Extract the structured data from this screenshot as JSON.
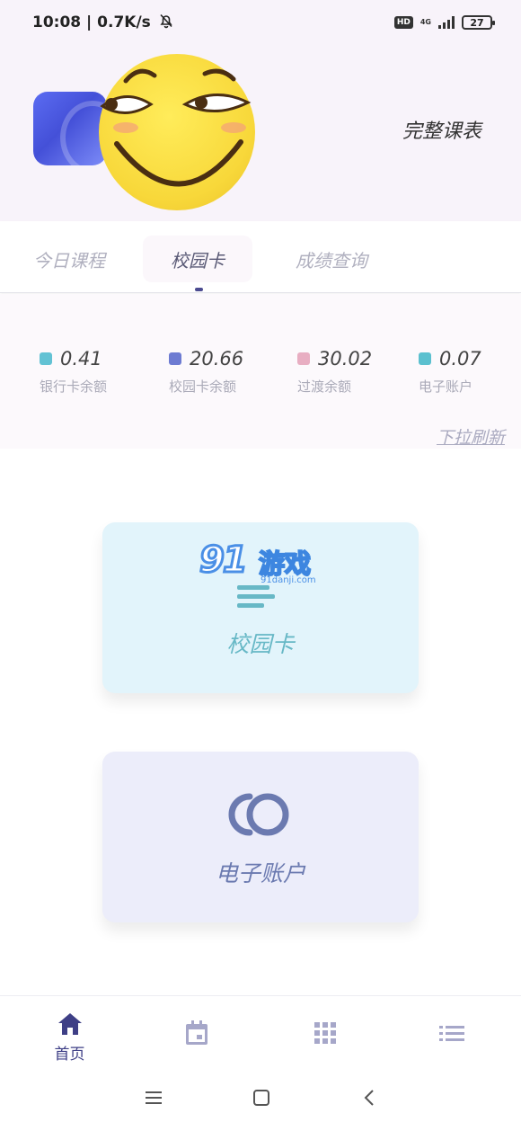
{
  "status_bar": {
    "time_speed": "10:08 | 0.7K/s",
    "hd_badge": "HD",
    "network": "4G",
    "battery": "27"
  },
  "header": {
    "full_schedule": "完整课表"
  },
  "tabs": [
    {
      "label": "今日课程",
      "active": false
    },
    {
      "label": "校园卡",
      "active": true
    },
    {
      "label": "成绩查询",
      "active": false
    }
  ],
  "balances": [
    {
      "value": "0.41",
      "label": "银行卡余额",
      "color": "#62c2d4"
    },
    {
      "value": "20.66",
      "label": "校园卡余额",
      "color": "#6d7bd2"
    },
    {
      "value": "30.02",
      "label": "过渡余额",
      "color": "#e8aec2"
    },
    {
      "value": "0.07",
      "label": "电子账户",
      "color": "#5bc0cf"
    }
  ],
  "pull_refresh": "下拉刷新",
  "cards": {
    "campus": {
      "label": "校园卡"
    },
    "wallet": {
      "label": "电子账户"
    }
  },
  "watermark": {
    "brand": "91",
    "text": "游戏",
    "url": "91danji.com"
  },
  "bottom_nav": {
    "home_label": "首页",
    "items": [
      "home-icon",
      "calendar-icon",
      "grid-icon",
      "list-icon"
    ],
    "active_color": "#3e3f86",
    "inactive_color": "#a6a7c9"
  }
}
